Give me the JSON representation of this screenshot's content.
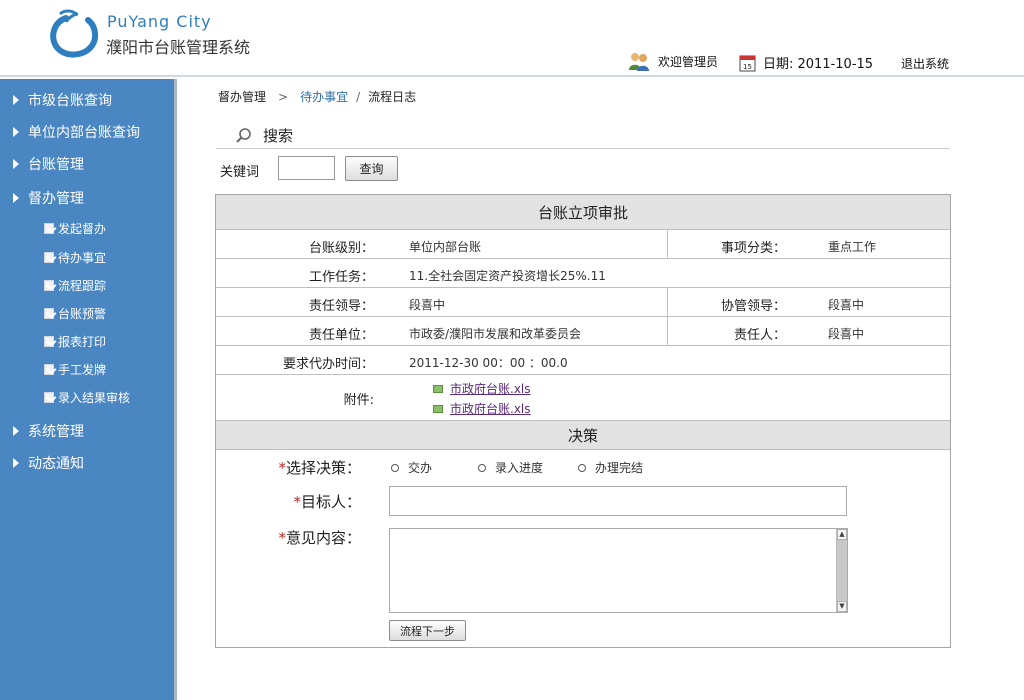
{
  "header": {
    "logo_en": "PuYang City",
    "logo_cn": "濮阳市台账管理系统",
    "welcome": "欢迎管理员",
    "date": "日期: 2011-10-15",
    "logout": "退出系统"
  },
  "sidebar": {
    "items": [
      {
        "label": "市级台账查询"
      },
      {
        "label": "单位内部台账查询"
      },
      {
        "label": "台账管理"
      },
      {
        "label": "督办管理"
      },
      {
        "label": "系统管理"
      },
      {
        "label": "动态通知"
      }
    ],
    "sub_items": [
      {
        "label": "发起督办"
      },
      {
        "label": "待办事宜"
      },
      {
        "label": "流程跟踪"
      },
      {
        "label": "台账预警"
      },
      {
        "label": "报表打印"
      },
      {
        "label": "手工发牌"
      },
      {
        "label": "录入结果审核"
      }
    ]
  },
  "breadcrumb": {
    "item1": "督办管理",
    "sep1": ">",
    "item2": "待办事宜",
    "sep2": "/",
    "item3": "流程日志"
  },
  "search": {
    "title": "搜索",
    "keyword_label": "关键词",
    "keyword_value": "",
    "query_button": "查询"
  },
  "form": {
    "title": "台账立项审批",
    "level_label": "台账级别：",
    "level_value": "单位内部台账",
    "category_label": "事项分类：",
    "category_value": "重点工作",
    "task_label": "工作任务：",
    "task_value": "11.全社会固定资产投资增长25%.11",
    "leader_label": "责任领导：",
    "leader_value": "段喜中",
    "co_leader_label": "协管领导：",
    "co_leader_value": "段喜中",
    "unit_label": "责任单位：",
    "unit_value": "市政委/濮阳市发展和改革委员会",
    "person_label": "责任人：",
    "person_value": "段喜中",
    "deadline_label": "要求代办时间：",
    "deadline_value": "2011-12-30  00：00 ：00.0",
    "attach_label": "附件:",
    "attachments": [
      "市政府台账.xls",
      "市政府台账.xls"
    ]
  },
  "decision": {
    "title": "决策",
    "required_mark": "*",
    "choose_label": "选择决策：",
    "options": [
      "交办",
      "录入进度",
      "办理完结"
    ],
    "target_label": "目标人：",
    "target_value": "",
    "opinion_label": "意见内容：",
    "opinion_value": "",
    "next_button": "流程下一步"
  }
}
